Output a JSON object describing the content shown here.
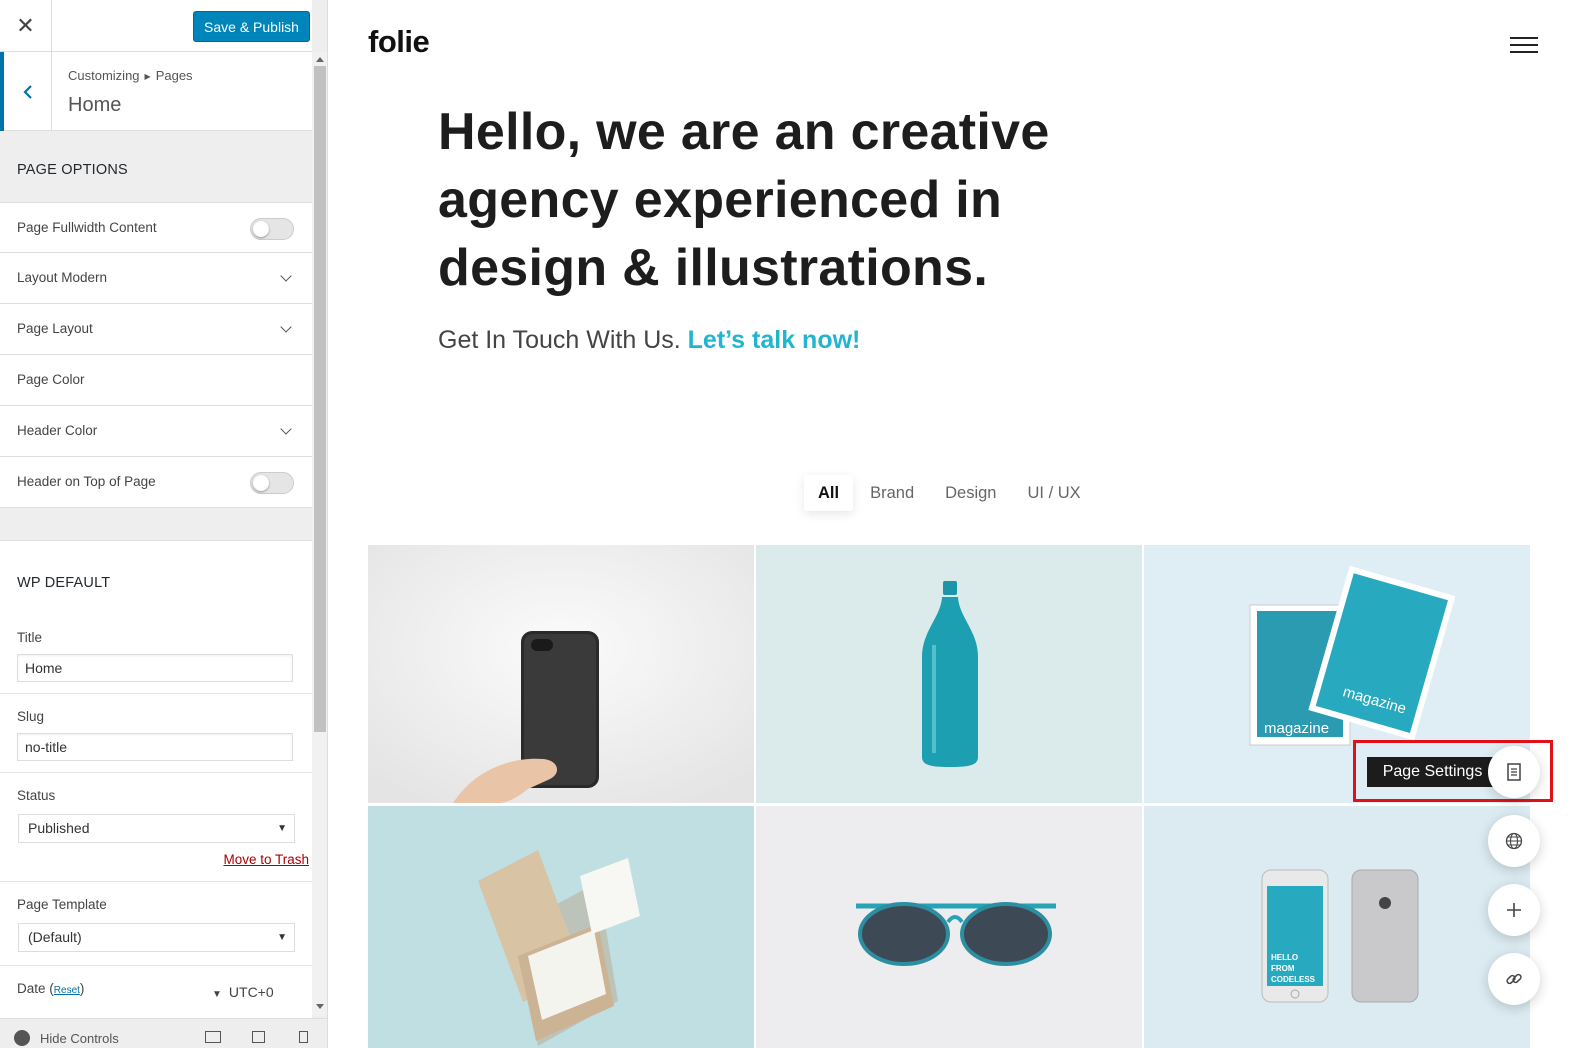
{
  "customizer": {
    "close_icon": "close-icon",
    "publish_label": "Save & Publish",
    "breadcrumb": {
      "root": "Customizing",
      "parent": "Pages"
    },
    "page_name": "Home",
    "sections": {
      "page_options": {
        "title": "PAGE OPTIONS",
        "items": [
          {
            "label": "Page Fullwidth Content",
            "control": "toggle",
            "on": false
          },
          {
            "label": "Layout Modern",
            "control": "chevron"
          },
          {
            "label": "Page Layout",
            "control": "chevron"
          },
          {
            "label": "Page Color",
            "control": "none"
          },
          {
            "label": "Header Color",
            "control": "chevron"
          },
          {
            "label": "Header on Top of Page",
            "control": "toggle",
            "on": false
          }
        ]
      },
      "wp_default": {
        "title": "WP DEFAULT",
        "title_label": "Title",
        "title_value": "Home",
        "slug_label": "Slug",
        "slug_value": "no-title",
        "status_label": "Status",
        "status_value": "Published",
        "trash_link": "Move to Trash",
        "template_label": "Page Template",
        "template_value": "(Default)",
        "date_label": "Date",
        "reset_link": "Reset",
        "timezone": "UTC+0"
      }
    },
    "footer": {
      "hide_controls": "Hide Controls"
    }
  },
  "preview": {
    "logo": "folie",
    "hero_line1": "Hello, we are an creative",
    "hero_line2": "agency experienced in",
    "hero_line3": "design & illustrations.",
    "subtitle": "Get In Touch With Us.",
    "cta": "Let’s talk now!",
    "filters": [
      "All",
      "Brand",
      "Design",
      "UI / UX"
    ],
    "active_filter": "All",
    "portfolio": [
      {
        "name": "black-phone",
        "bg": "#f0f0f0"
      },
      {
        "name": "teal-bottle",
        "bg": "#dceced"
      },
      {
        "name": "magazine",
        "bg": "#dfeff4"
      },
      {
        "name": "business-cards",
        "bg": "#c0e0e2"
      },
      {
        "name": "sunglasses",
        "bg": "#ededf0"
      },
      {
        "name": "iphones",
        "bg": "#dcecf2"
      }
    ],
    "magazine_text_1": "magazine",
    "magazine_text_2": "magazine",
    "phone_screen_text": [
      "HELLO",
      "FROM",
      "CODELESS"
    ],
    "tooltip": "Page Settings",
    "fab_icons": [
      "document-icon",
      "globe-icon",
      "plus-icon",
      "link-icon"
    ]
  },
  "colors": {
    "publish": "#0085ba",
    "accent": "#23b5d0",
    "highlight": "#e0111a",
    "trash": "#aa0000"
  }
}
